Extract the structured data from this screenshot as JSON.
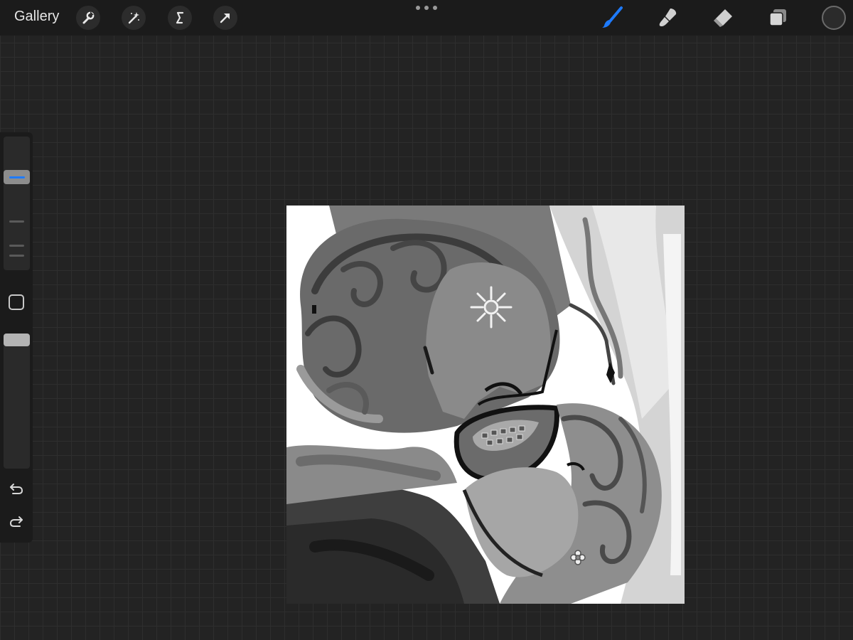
{
  "topbar": {
    "gallery_label": "Gallery",
    "left_tools": [
      "wrench-icon",
      "magic-wand-icon",
      "selection-s-icon",
      "transform-arrow-icon"
    ],
    "right_tools": [
      "brush-icon",
      "smudge-icon",
      "eraser-icon",
      "layers-icon"
    ],
    "active_tool": "brush",
    "accent_color": "#1e7bff",
    "current_color": "#2b2b2b"
  },
  "sidebar": {
    "brush_size_level": 0.72,
    "opacity_level": 1.0,
    "controls": [
      "modify-square-icon",
      "undo-icon",
      "redo-icon"
    ]
  },
  "canvas": {
    "background": "#ffffff",
    "content": "grayscale-illustration"
  }
}
